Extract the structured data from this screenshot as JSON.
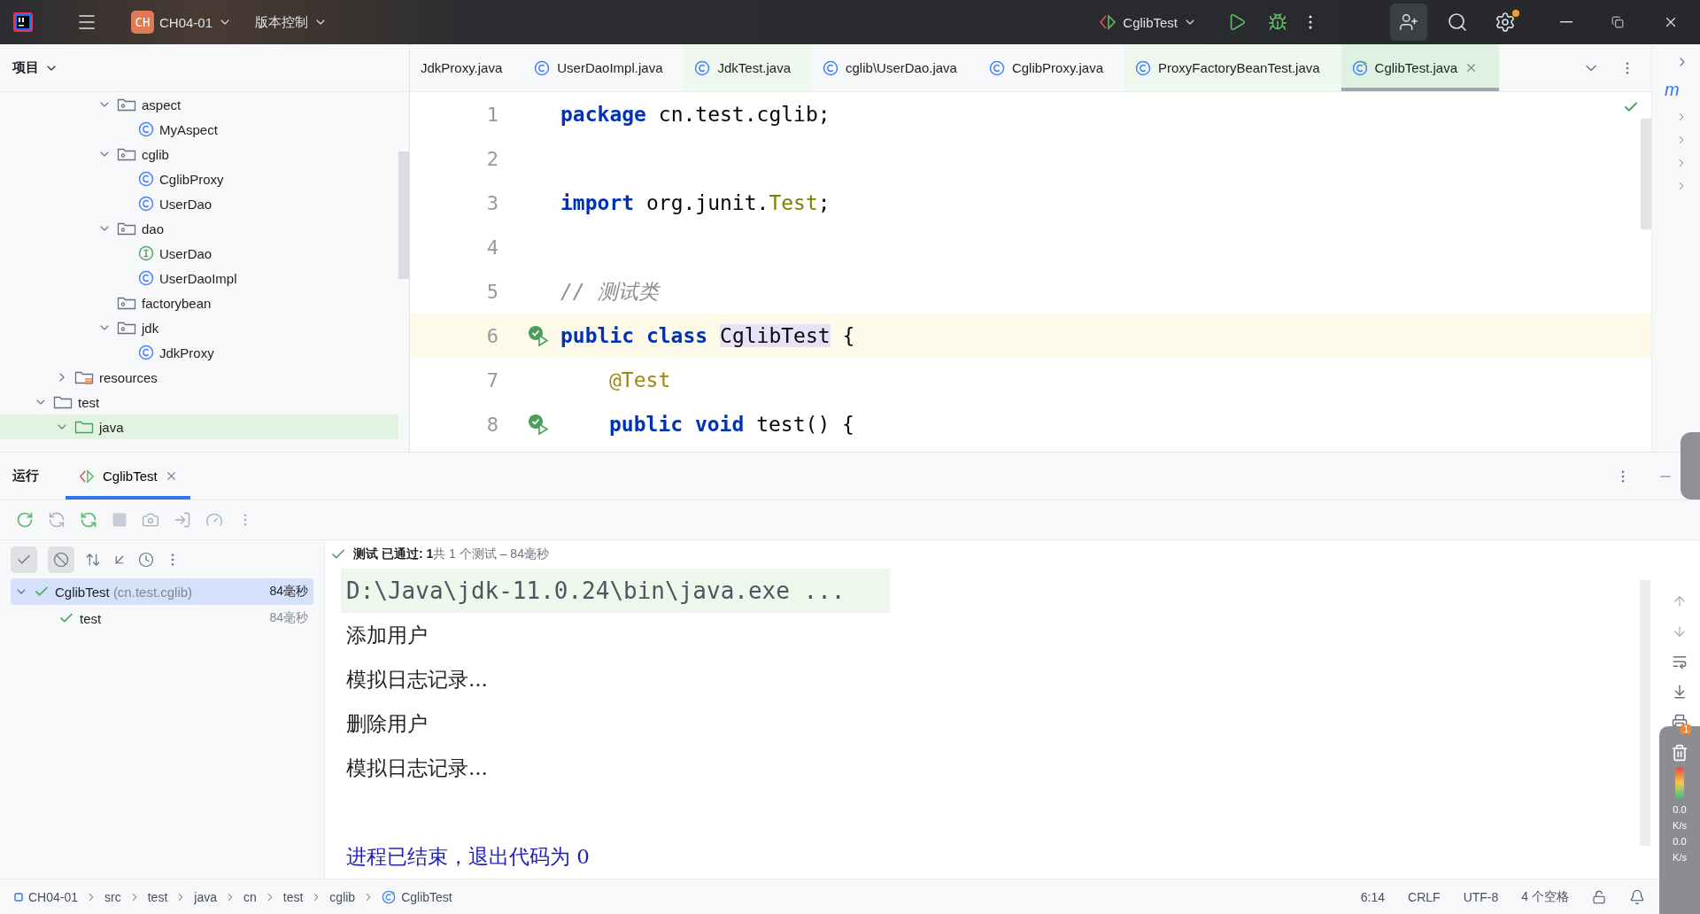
{
  "title_bar": {
    "project_badge": "CH",
    "project": "CH04-01",
    "vcs": "版本控制",
    "run_config": "CglibTest",
    "settings_badge": true
  },
  "project_panel": {
    "title": "项目",
    "tree": [
      {
        "children": [
          {
            "children": [
              {
                "children": [
                  {
                    "label": "aspect",
                    "kind": "package",
                    "expanded": true,
                    "selected": false,
                    "children": [
                      {
                        "label": "MyAspect",
                        "kind": "class",
                        "selected": false
                      }
                    ]
                  },
                  {
                    "label": "cglib",
                    "kind": "package",
                    "expanded": true,
                    "selected": false,
                    "children": [
                      {
                        "label": "CglibProxy",
                        "kind": "class",
                        "selected": false
                      },
                      {
                        "label": "UserDao",
                        "kind": "class",
                        "selected": false
                      }
                    ]
                  },
                  {
                    "label": "dao",
                    "kind": "package",
                    "expanded": true,
                    "selected": false,
                    "children": [
                      {
                        "label": "UserDao",
                        "kind": "interface",
                        "selected": false
                      },
                      {
                        "label": "UserDaoImpl",
                        "kind": "class",
                        "selected": false
                      }
                    ]
                  },
                  {
                    "label": "factorybean",
                    "kind": "package",
                    "selected": false
                  },
                  {
                    "label": "jdk",
                    "kind": "package",
                    "expanded": true,
                    "selected": false,
                    "children": [
                      {
                        "label": "JdkProxy",
                        "kind": "class",
                        "selected": false
                      }
                    ]
                  }
                ]
              }
            ]
          },
          {
            "label": "resources",
            "kind": "resources",
            "expanded": false,
            "selected": false
          }
        ]
      },
      {
        "label": "test",
        "kind": "folder",
        "expanded": true,
        "selected": false,
        "children": [
          {
            "label": "java",
            "kind": "test_root",
            "expanded": true,
            "selected": true
          }
        ]
      }
    ]
  },
  "editor_tabs": [
    {
      "label": "JdkProxy.java",
      "kind": "plain",
      "test_file": false,
      "selected": false
    },
    {
      "label": "UserDaoImpl.java",
      "kind": "class",
      "test_file": false,
      "selected": false
    },
    {
      "label": "JdkTest.java",
      "kind": "class",
      "test_file": true,
      "selected": false
    },
    {
      "label": "cglib\\UserDao.java",
      "kind": "class",
      "test_file": false,
      "selected": false
    },
    {
      "label": "CglibProxy.java",
      "kind": "class",
      "test_file": false,
      "selected": false
    },
    {
      "label": "ProxyFactoryBeanTest.java",
      "kind": "class",
      "test_file": true,
      "selected": false
    },
    {
      "label": "CglibTest.java",
      "kind": "test_class",
      "test_file": true,
      "selected": true
    }
  ],
  "code": [
    {
      "number": "1",
      "current": false,
      "tokens": [
        {
          "kind": "keyword",
          "text": "package"
        },
        {
          "kind": "plain",
          "text": " cn.test.cglib;"
        }
      ]
    },
    {
      "number": "2",
      "current": false
    },
    {
      "number": "3",
      "current": false,
      "tokens": [
        {
          "kind": "keyword",
          "text": "import"
        },
        {
          "kind": "plain",
          "text": " org.junit."
        },
        {
          "kind": "type",
          "text": "Test"
        },
        {
          "kind": "plain",
          "text": ";"
        }
      ]
    },
    {
      "number": "4",
      "current": false
    },
    {
      "number": "5",
      "current": false,
      "tokens": [
        {
          "kind": "comment",
          "text": "// 测试类"
        }
      ]
    },
    {
      "number": "6",
      "current": true,
      "run_gutter": true,
      "tokens": [
        {
          "kind": "keyword",
          "text": "public class"
        },
        {
          "kind": "usage",
          "text": "CglibTest",
          "space_before": true
        },
        {
          "kind": "plain",
          "text": " {"
        }
      ],
      "children": [
        {
          "number": "7",
          "current": false,
          "tokens": [
            {
              "kind": "annotation",
              "text": "@Test"
            }
          ]
        },
        {
          "number": "8",
          "current": false,
          "run_gutter": true,
          "tokens": [
            {
              "kind": "keyword",
              "text": "public void"
            },
            {
              "kind": "plain",
              "text": " test() {"
            }
          ]
        }
      ]
    }
  ],
  "structure": {
    "item": "m"
  },
  "run_panel": {
    "title": "运行",
    "tabs": [
      {
        "label": "CglibTest",
        "selected": true
      }
    ],
    "filters": [
      {
        "kind": "passed",
        "on": true
      },
      {
        "kind": "ignored",
        "on": true
      }
    ],
    "summary": "**测试 已通过: 1**共 1 个测试 – 84毫秒",
    "tests": [
      {
        "name": "CglibTest",
        "detail": "(cn.test.cglib)",
        "time": "84毫秒",
        "passed": true,
        "selected": true,
        "expanded": true,
        "children": [
          {
            "name": "test",
            "time": "84毫秒",
            "passed": true,
            "selected": false
          }
        ]
      }
    ],
    "console": [
      {
        "kind": "command",
        "text": "D:\\Java\\jdk-11.0.24\\bin\\java.exe ..."
      },
      {
        "kind": "output",
        "text": "添加用户"
      },
      {
        "kind": "output",
        "text": "模拟日志记录..."
      },
      {
        "kind": "output",
        "text": "删除用户"
      },
      {
        "kind": "output",
        "text": "模拟日志记录..."
      },
      {
        "kind": "blank"
      },
      {
        "kind": "exit",
        "text": "进程已结束，退出代码为 0"
      }
    ]
  },
  "monitor": {
    "badge": "1",
    "upload": "0.0",
    "upload_unit": "K/s",
    "download": "0.0",
    "download_unit": "K/s"
  },
  "status_bar": {
    "breadcrumbs": [
      {
        "label": "CH04-01",
        "kind": "module"
      },
      {
        "label": "src",
        "kind": "plain"
      },
      {
        "label": "test",
        "kind": "plain"
      },
      {
        "label": "java",
        "kind": "plain"
      },
      {
        "label": "cn",
        "kind": "plain"
      },
      {
        "label": "test",
        "kind": "plain"
      },
      {
        "label": "cglib",
        "kind": "plain"
      },
      {
        "label": "CglibTest",
        "kind": "test_class"
      }
    ],
    "position": "6:14",
    "line_separator": "CRLF",
    "encoding": "UTF-8",
    "indent": "4 个空格"
  }
}
